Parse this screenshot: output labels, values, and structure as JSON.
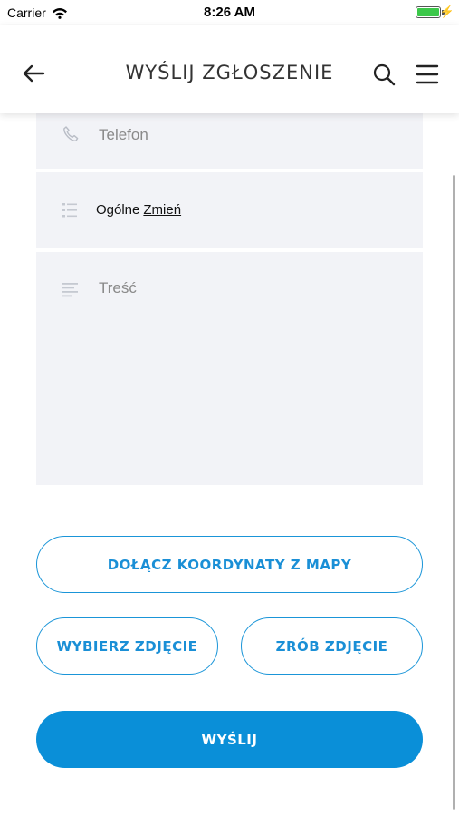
{
  "status_bar": {
    "carrier": "Carrier",
    "time": "8:26 AM",
    "battery_level": 1.0,
    "battery_color": "#3cc84a"
  },
  "header": {
    "title": "WYŚLIJ ZGŁOSZENIE",
    "back_icon": "arrow-left-icon",
    "search_icon": "search-icon",
    "menu_icon": "hamburger-menu-icon"
  },
  "form": {
    "phone": {
      "placeholder": "Telefon",
      "icon": "phone-icon"
    },
    "category": {
      "value": "Ogólne",
      "change_label": "Zmień",
      "icon": "list-icon"
    },
    "body": {
      "placeholder": "Treść",
      "icon": "text-lines-icon"
    }
  },
  "buttons": {
    "attach_coords": "DOŁĄCZ KOORDYNATY Z MAPY",
    "pick_photo": "WYBIERZ ZDJĘCIE",
    "take_photo": "ZRÓB ZDJĘCIE",
    "send": "WYŚLIJ"
  },
  "colors": {
    "accent": "#0a8fd8",
    "field_bg": "#f2f3f7"
  }
}
